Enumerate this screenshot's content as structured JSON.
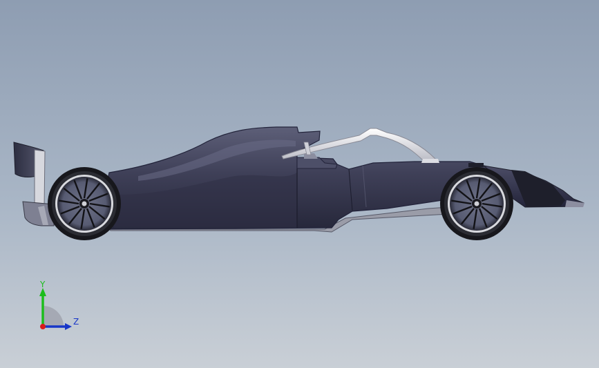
{
  "viewport": {
    "background_top": "#8e9db2",
    "background_bottom": "#c9cfd6",
    "model": {
      "description_icon": "formula-car-side-view",
      "body_color": "#3c3d52",
      "halo_color": "#e8e8ec",
      "tire_color": "#1a1a1e",
      "wheel_spokes": 12
    },
    "triad": {
      "y_label": "Y",
      "z_label": "Z",
      "y_color": "#1cbd1c",
      "z_color": "#1836c8",
      "origin_color": "#d81c1c"
    }
  }
}
